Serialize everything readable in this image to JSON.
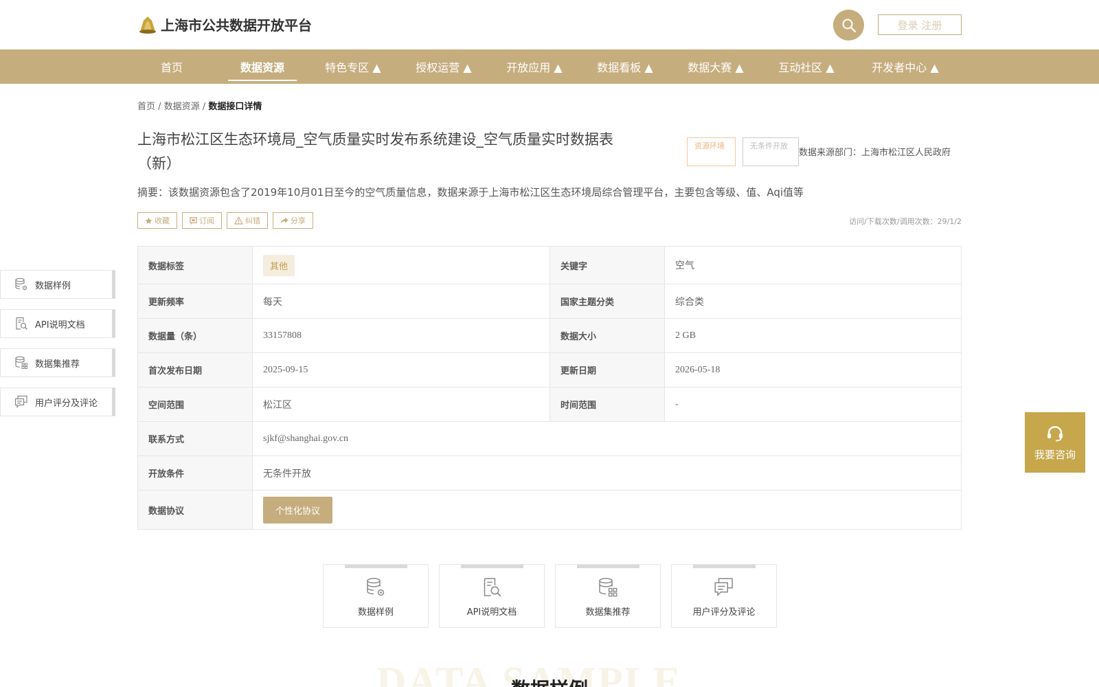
{
  "header": {
    "site_title": "上海市公共数据开放平台",
    "login_label": "登录 注册"
  },
  "nav": {
    "items": [
      {
        "label": "首页"
      },
      {
        "label": "数据资源"
      },
      {
        "label": "特色专区 ▲"
      },
      {
        "label": "授权运营 ▲"
      },
      {
        "label": "开放应用 ▲"
      },
      {
        "label": "数据看板 ▲"
      },
      {
        "label": "数据大赛 ▲"
      },
      {
        "label": "互动社区 ▲"
      },
      {
        "label": "开发者中心 ▲"
      }
    ],
    "active_index": 1
  },
  "breadcrumb": {
    "home": "首页",
    "sep": " / ",
    "resources": "数据资源",
    "current": "数据接口详情"
  },
  "detail": {
    "title": "上海市松江区生态环境局_空气质量实时发布系统建设_空气质量实时数据表（新）",
    "tag_topic": "资源环境",
    "tag_open": "无条件开放",
    "source_dept": "数据来源部门：上海市松江区人民政府",
    "summary": "摘要：该数据资源包含了2019年10月01日至今的空气质量信息，数据来源于上海市松江区生态环境局综合管理平台，主要包含等级、值、Aqi值等",
    "actions": {
      "favorite": "收藏",
      "subscribe": "订阅",
      "report": "纠错",
      "share": "分享"
    },
    "stats": "访问/下载次数/调用次数：29/1/2"
  },
  "table": {
    "data_tag_label": "数据标签",
    "data_tag_value": "其他",
    "keyword_label": "关键字",
    "keyword_value": "空气",
    "freq_label": "更新频率",
    "freq_value": "每天",
    "theme_label": "国家主题分类",
    "theme_value": "综合类",
    "count_label": "数据量（条）",
    "count_value": "33157808",
    "size_label": "数据大小",
    "size_value": "2 GB",
    "first_pub_label": "首次发布日期",
    "first_pub_value": "2025-09-15",
    "update_label": "更新日期",
    "update_value": "2026-05-18",
    "space_label": "空间范围",
    "space_value": "松江区",
    "time_label": "时间范围",
    "time_value": "-",
    "contact_label": "联系方式",
    "contact_value": "sjkf@shanghai.gov.cn",
    "condition_label": "开放条件",
    "condition_value": "无条件开放",
    "protocol_label": "数据协议",
    "protocol_button": "个性化协议"
  },
  "side_menu": {
    "items": [
      {
        "label": "数据样例",
        "icon": "database-gear-icon"
      },
      {
        "label": "API说明文档",
        "icon": "document-search-icon"
      },
      {
        "label": "数据集推荐",
        "icon": "database-grid-icon"
      },
      {
        "label": "用户评分及评论",
        "icon": "comment-icon"
      }
    ]
  },
  "consult": {
    "label": "我要咨询",
    "icon": "headset-icon"
  },
  "cards": {
    "items": [
      {
        "label": "数据样例",
        "icon": "database-gear-icon"
      },
      {
        "label": "API说明文档",
        "icon": "document-search-icon"
      },
      {
        "label": "数据集推荐",
        "icon": "database-grid-icon"
      },
      {
        "label": "用户评分及评论",
        "icon": "comment-icon"
      }
    ]
  },
  "section": {
    "bg_text": "DATA SAMPLE",
    "title": "数据样例"
  },
  "colors": {
    "brand": "#c6ad7e",
    "consult": "#c6a74c",
    "tag_bg": "#f5eddd"
  }
}
